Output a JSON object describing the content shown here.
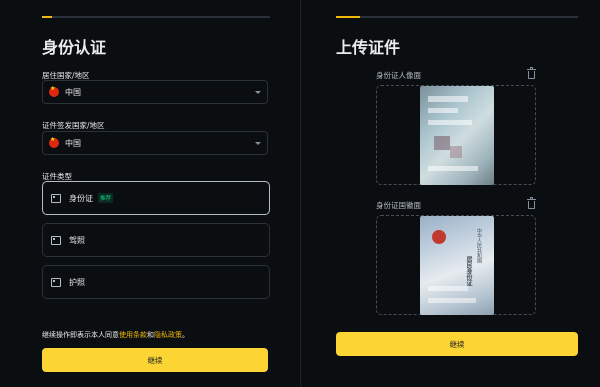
{
  "left": {
    "title": "身份认证",
    "residence": {
      "label": "居住国家/地区",
      "value": "中国"
    },
    "issuing": {
      "label": "证件签发国家/地区",
      "value": "中国"
    },
    "doc_type": {
      "label": "证件类型",
      "options": [
        {
          "label": "身份证",
          "badge": "推荐",
          "selected": true
        },
        {
          "label": "驾照",
          "selected": false
        },
        {
          "label": "护照",
          "selected": false
        }
      ]
    },
    "terms": {
      "prefix": "继续操作即表示本人同意",
      "link1": "使用条款",
      "and": "和",
      "link2": "隐私政策",
      "suffix": "。"
    },
    "continue": "继续"
  },
  "right": {
    "title": "上传证件",
    "front_label": "身份证人像面",
    "back_label": "身份证国徽面",
    "back_card_text": "中华人民共和国",
    "back_card_text2": "居民身份证",
    "continue": "继续"
  },
  "colors": {
    "accent": "#f0b90b",
    "button": "#fcd535",
    "background": "#0b0e11"
  }
}
